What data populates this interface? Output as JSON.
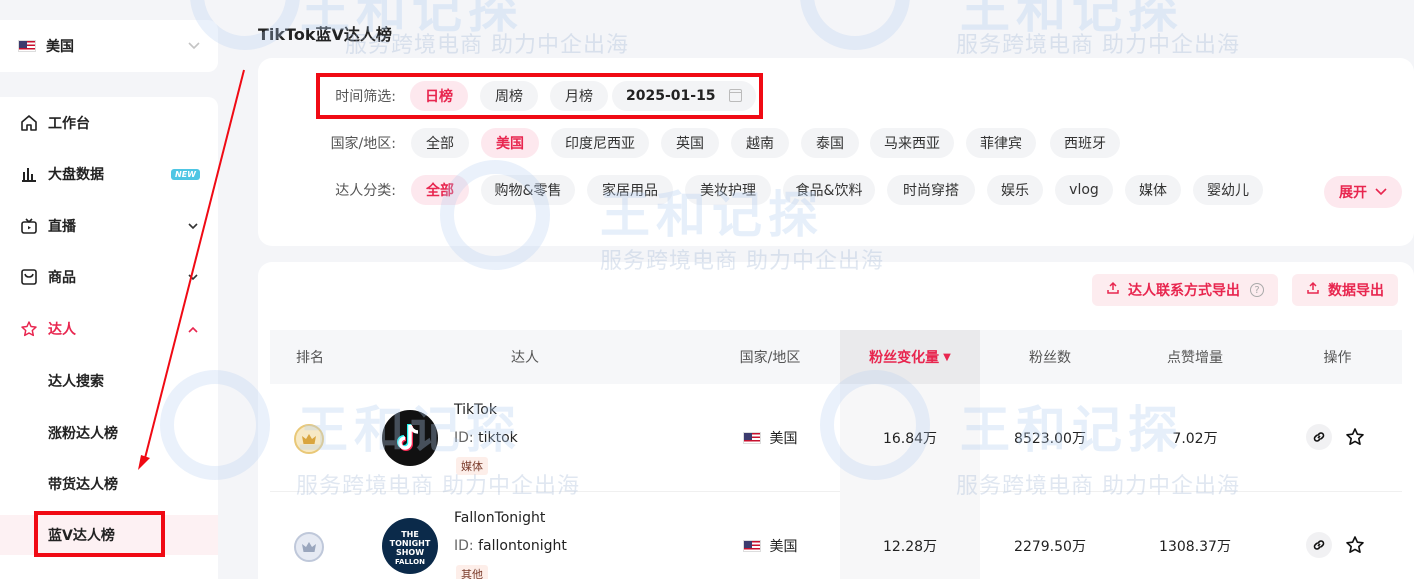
{
  "sidebar": {
    "country": {
      "label": "美国"
    },
    "nav": [
      {
        "label": "工作台",
        "icon": "home-icon"
      },
      {
        "label": "大盘数据",
        "icon": "bar-chart-icon",
        "badge": "NEW"
      },
      {
        "label": "直播",
        "icon": "live-tv-icon"
      },
      {
        "label": "商品",
        "icon": "product-box-icon"
      },
      {
        "label": "达人",
        "icon": "creator-star-icon"
      }
    ],
    "sub_items": [
      "达人搜索",
      "涨粉达人榜",
      "带货达人榜",
      "蓝V达人榜"
    ]
  },
  "page": {
    "title": "TikTok蓝V达人榜"
  },
  "filters": {
    "time_label": "时间筛选:",
    "time_options": [
      "日榜",
      "周榜",
      "月榜"
    ],
    "time_selected": "日榜",
    "date_value": "2025-01-15",
    "country_label": "国家/地区:",
    "country_options": [
      "全部",
      "美国",
      "印度尼西亚",
      "英国",
      "越南",
      "泰国",
      "马来西亚",
      "菲律宾",
      "西班牙"
    ],
    "country_selected": "美国",
    "category_label": "达人分类:",
    "category_options": [
      "全部",
      "购物&零售",
      "家居用品",
      "美妆护理",
      "食品&饮料",
      "时尚穿搭",
      "娱乐",
      "vlog",
      "媒体",
      "婴幼儿"
    ],
    "category_selected": "全部",
    "expand_label": "展开"
  },
  "toolbar": {
    "export_contact_label": "达人联系方式导出",
    "export_data_label": "数据导出"
  },
  "table": {
    "columns": [
      "排名",
      "达人",
      "国家/地区",
      "粉丝变化量",
      "粉丝数",
      "点赞增量",
      "操作"
    ],
    "sorted_column": "粉丝变化量",
    "rows": [
      {
        "name": "TikTok",
        "id_label": "ID:",
        "id": "tiktok",
        "tag": "媒体",
        "country": "美国",
        "fans_change": "16.84万",
        "fans": "8523.00万",
        "likes_increase": "7.02万"
      },
      {
        "name": "FallonTonight",
        "id_label": "ID:",
        "id": "fallontonight",
        "tag": "其他",
        "country": "美国",
        "fans_change": "12.28万",
        "fans": "2279.50万",
        "likes_increase": "1308.37万"
      }
    ]
  },
  "watermark": {
    "brand": "王和记探",
    "slogan": "服务跨境电商 助力中企出海"
  },
  "colors": {
    "accent": "#e8264f",
    "annotation_red": "#f00a14",
    "badge_new": "#4ec6e4"
  }
}
